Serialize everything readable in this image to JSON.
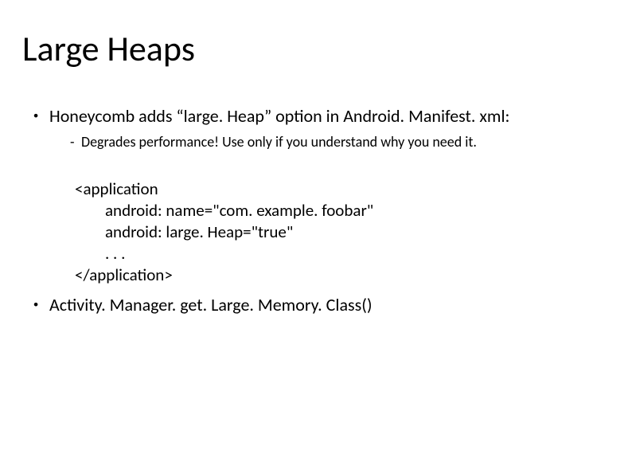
{
  "title": "Large Heaps",
  "bullet1": "Honeycomb adds “large. Heap” option in Android. Manifest. xml:",
  "sub1": "Degrades performance! Use only if you understand why you need it.",
  "code": {
    "l1": "<application",
    "l2": "android: name=\"com. example. foobar\"",
    "l3": "android: large. Heap=\"true\"",
    "l4": ". . .",
    "l5": "</application>"
  },
  "bullet2": "Activity. Manager. get. Large. Memory. Class()",
  "glyphs": {
    "dot": "●",
    "dash": "-"
  }
}
